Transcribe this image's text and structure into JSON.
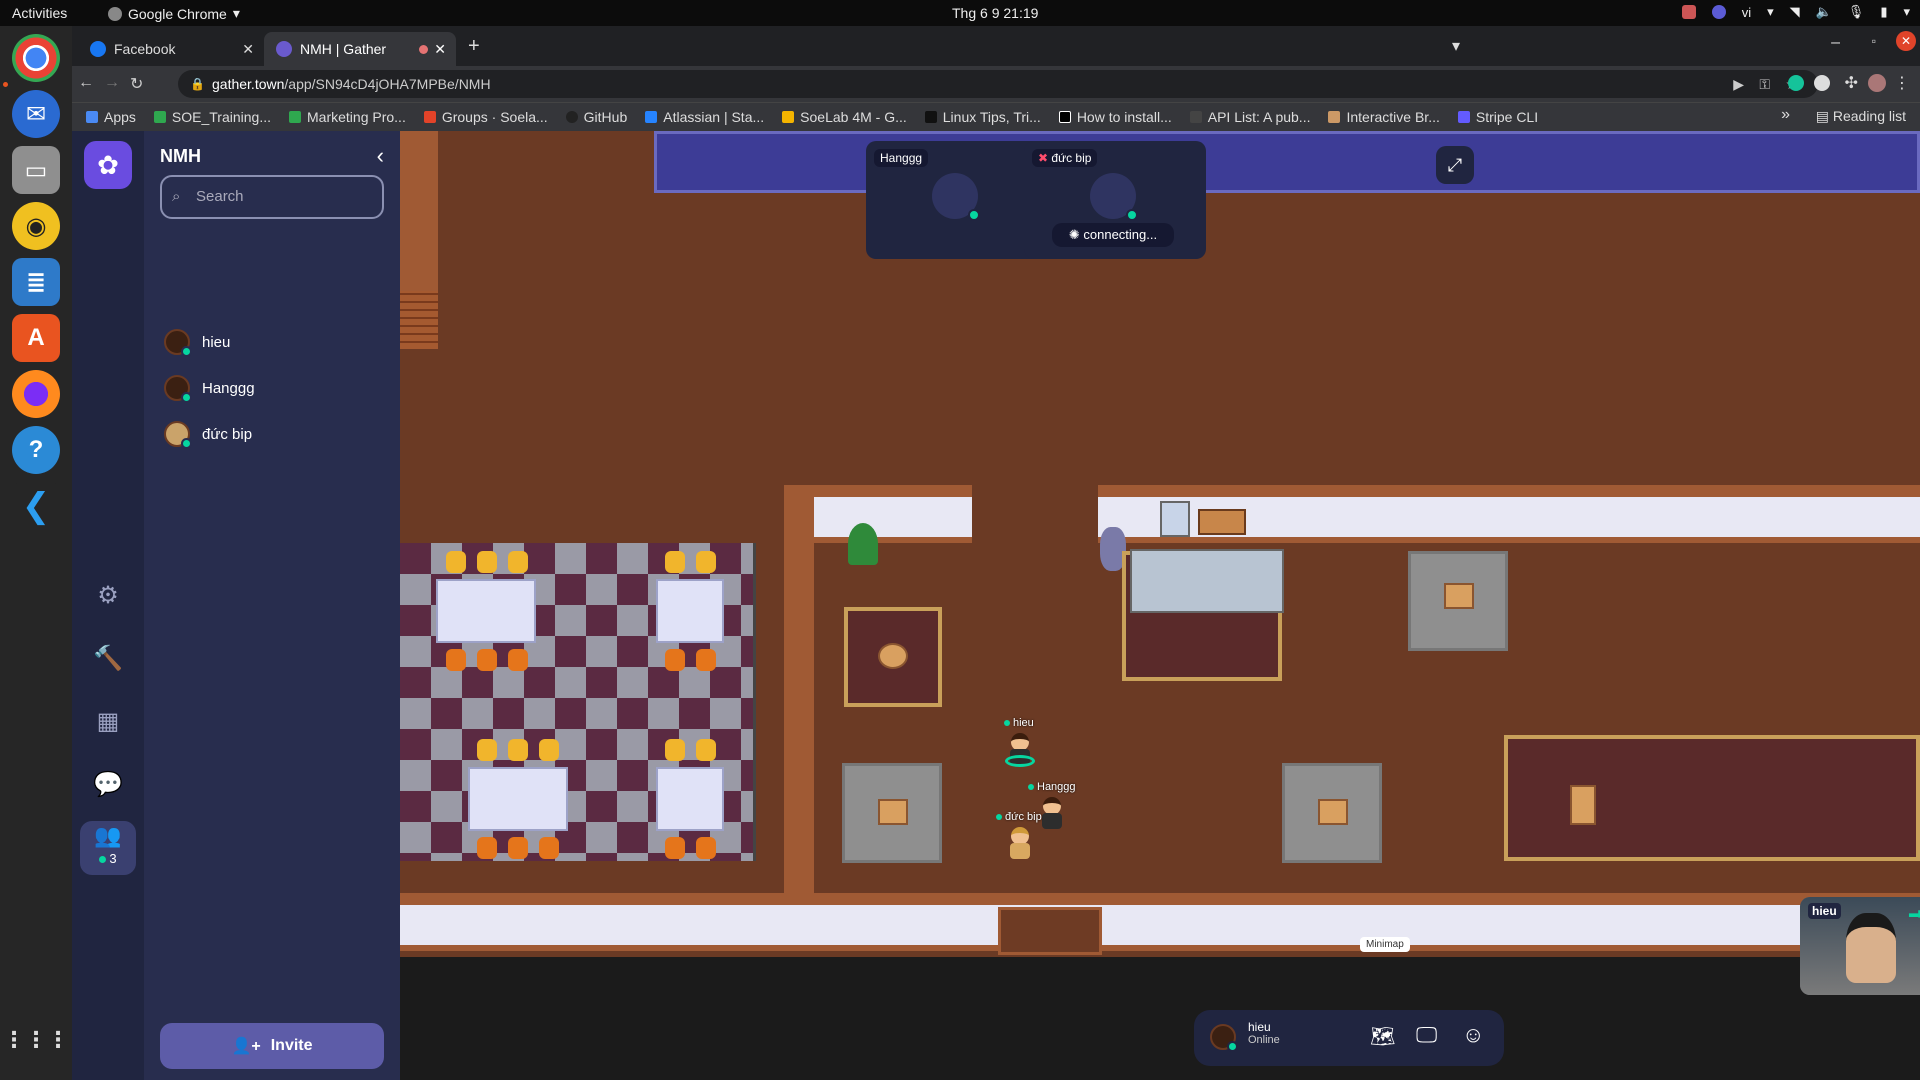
{
  "system": {
    "activities": "Activities",
    "app_name": "Google Chrome",
    "clock": "Thg 6 9  21:19",
    "language": "vi"
  },
  "browser": {
    "tabs": [
      {
        "label": "Facebook",
        "active": false
      },
      {
        "label": "NMH | Gather",
        "active": true
      }
    ],
    "url_host": "gather.town",
    "url_path": "/app/SN94cD4jOHA7MPBe/NMH",
    "bookmarks": [
      "Apps",
      "SOE_Training...",
      "Marketing Pro...",
      "Groups · Soela...",
      "GitHub",
      "Atlassian | Sta...",
      "SoeLab 4M - G...",
      "Linux Tips, Tri...",
      "How to install...",
      "API List: A pub...",
      "Interactive Br...",
      "Stripe CLI"
    ],
    "bookmarks_overflow": "»",
    "reading_list": "Reading list"
  },
  "gather": {
    "space_name": "NMH",
    "search_placeholder": "Search",
    "members": [
      {
        "name": "hieu"
      },
      {
        "name": "Hanggg"
      },
      {
        "name": "đức bip"
      }
    ],
    "invite_label": "Invite",
    "people_count": "3",
    "video_cards": [
      {
        "name": "Hanggg",
        "status": ""
      },
      {
        "name": "đức bip",
        "status": "connecting..."
      }
    ],
    "map_characters": [
      {
        "name": "hieu"
      },
      {
        "name": "Hanggg"
      },
      {
        "name": "đức bip"
      }
    ],
    "minimap_label": "Minimap",
    "self": {
      "name": "hieu",
      "status": "Online"
    },
    "self_view_label": "hieu"
  },
  "colors": {
    "rail_bg": "#202540",
    "panel_bg": "#282d4e",
    "online_dot": "#06d6a0",
    "invite_bg": "#5d5ca8",
    "floor": "#6b3a24"
  }
}
